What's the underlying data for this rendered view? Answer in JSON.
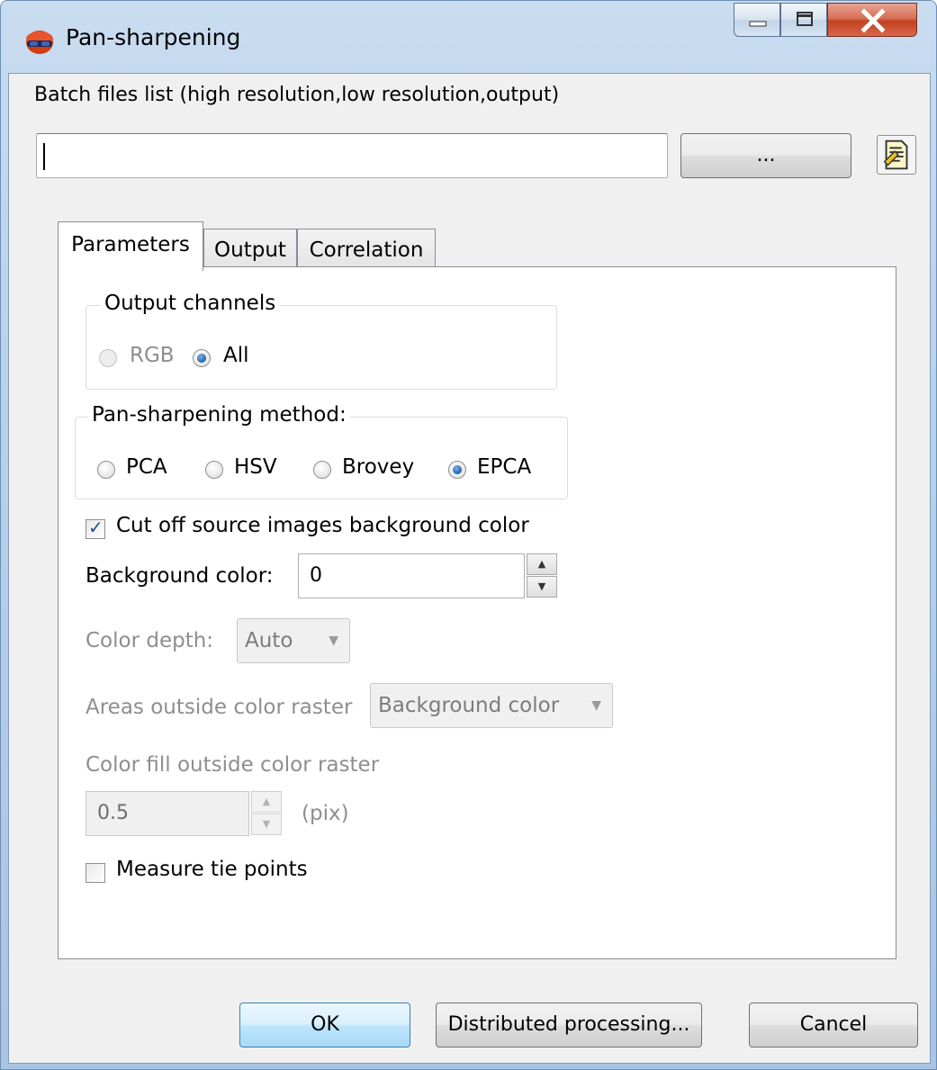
{
  "window": {
    "title": "Pan-sharpening",
    "caption_buttons": {
      "minimize": "—",
      "maximize": "□",
      "close": "X"
    }
  },
  "batch": {
    "label": "Batch files list (high resolution,low resolution,output)",
    "input_value": "",
    "browse_label": "..."
  },
  "tabs": [
    {
      "label": "Parameters",
      "active": true
    },
    {
      "label": "Output",
      "active": false
    },
    {
      "label": "Correlation",
      "active": false
    }
  ],
  "output_channels": {
    "title": "Output channels",
    "options": [
      {
        "label": "RGB",
        "checked": false,
        "enabled": false
      },
      {
        "label": "All",
        "checked": true,
        "enabled": true
      }
    ]
  },
  "method": {
    "title": "Pan-sharpening method:",
    "options": [
      {
        "label": "PCA",
        "checked": false
      },
      {
        "label": "HSV",
        "checked": false
      },
      {
        "label": "Brovey",
        "checked": false
      },
      {
        "label": "EPCA",
        "checked": true
      }
    ]
  },
  "cut_off": {
    "label": "Cut off source images background color",
    "checked": true
  },
  "background_color": {
    "label": "Background color:",
    "value": "0"
  },
  "color_depth": {
    "label": "Color depth:",
    "value": "Auto",
    "enabled": false
  },
  "areas_outside": {
    "label": "Areas outside color raster",
    "value": "Background color",
    "enabled": false
  },
  "color_fill": {
    "label": "Color fill outside color raster",
    "value": "0.5",
    "unit": "(pix)",
    "enabled": false
  },
  "measure_tie_points": {
    "label": "Measure tie points",
    "checked": false
  },
  "buttons": {
    "ok": "OK",
    "distributed": "Distributed processing...",
    "cancel": "Cancel"
  }
}
